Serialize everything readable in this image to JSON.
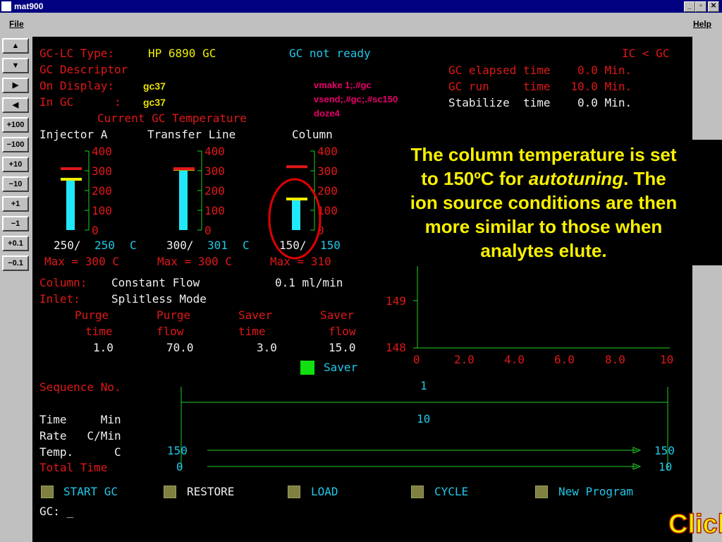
{
  "window": {
    "title": "mat900"
  },
  "menu": {
    "file": "File",
    "help": "Help"
  },
  "side_buttons": [
    "▲",
    "▼",
    "▶",
    "◀",
    "+100",
    "−100",
    "+10",
    "−10",
    "+1",
    "−1",
    "+0.1",
    "−0.1"
  ],
  "header": {
    "type_label": "GC-LC Type:",
    "type_value": "HP 6890 GC",
    "status": "GC not ready",
    "mode": "IC < GC",
    "descriptor_label": "GC Descriptor",
    "on_display_label": "On Display:",
    "on_display_value": "gc37",
    "in_gc_label": "In GC      :",
    "in_gc_value": "gc37",
    "commands": [
      "vmake 1;.#gc",
      "vsend;.#gc;.#sc150",
      "doze4"
    ],
    "elapsed": "GC elapsed time    0.0 Min.",
    "run": "GC run     time   10.0 Min.",
    "stabilize": "Stabilize  time    0.0 Min."
  },
  "temperature": {
    "title": "Current GC Temperature",
    "scale_ticks": [
      "400",
      "300",
      "200",
      "100",
      "0"
    ],
    "zones": [
      {
        "name": "Injector A",
        "actual": "250/",
        "set": "250",
        "unit": "C",
        "max": "Max = 300 C",
        "actual_value": 250,
        "set_value": 250,
        "max_value": 300
      },
      {
        "name": "Transfer Line",
        "actual": "300/",
        "set": "301",
        "unit": "C",
        "max": "Max = 300 C",
        "actual_value": 300,
        "set_value": 301,
        "max_value": 300
      },
      {
        "name": "Column",
        "actual": "150/",
        "set": "150",
        "unit": "",
        "max": "Max = 310",
        "actual_value": 150,
        "set_value": 150,
        "max_value": 310
      }
    ]
  },
  "column": {
    "label": "Column:",
    "mode": "Constant Flow",
    "flow": "0.1 ml/min",
    "inlet_label": "Inlet:",
    "inlet_mode": "Splitless Mode",
    "headers": [
      [
        "Purge",
        "time"
      ],
      [
        "Purge",
        "flow"
      ],
      [
        "Saver",
        "time"
      ],
      [
        "Saver",
        "flow"
      ]
    ],
    "values": [
      "1.0",
      "70.0",
      "3.0",
      "15.0"
    ],
    "saver_label": "Saver"
  },
  "plot": {
    "y_ticks": [
      "149",
      "148"
    ],
    "x_ticks": [
      "0",
      "2.0",
      "4.0",
      "6.0",
      "8.0",
      "10"
    ]
  },
  "sequence": {
    "label": "Sequence No.",
    "number": "1",
    "segment_time": "10",
    "time_label": "Time     Min",
    "rate_label": "Rate   C/Min",
    "temp_label": "Temp.      C",
    "total_label": "Total Time",
    "temp_start": "150",
    "temp_end": "150",
    "total_start": "0",
    "total_end": "10"
  },
  "actions": [
    "START GC",
    "RESTORE",
    "LOAD",
    "CYCLE",
    "New Program"
  ],
  "prompt": "GC: _",
  "callout": {
    "line1": "The column temperature is set",
    "line2a": "to 150ºC for ",
    "line2b": "autotuning",
    "line2c": ".  The",
    "line3": "ion source conditions are then",
    "line4": "more similar to those when",
    "line5": "analytes elute."
  },
  "click_text": "Click",
  "colors": {
    "bar": "#20e8f8",
    "setpoint": "#f0f000",
    "maxline": "#e01818",
    "axis": "#20d020"
  }
}
